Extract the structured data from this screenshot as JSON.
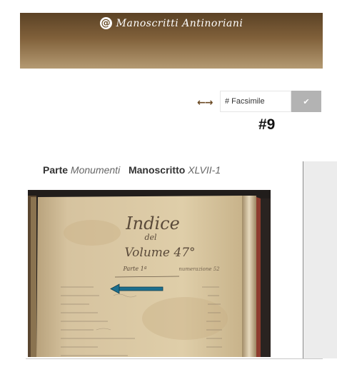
{
  "header": {
    "logo_mark": "@",
    "title": "Manoscritti Antinoriani"
  },
  "search": {
    "nav_arrows": "←→",
    "placeholder": "# Facsimile",
    "button_icon": "checkmark-icon"
  },
  "page_number": "#9",
  "meta": {
    "parte_label": "Parte",
    "parte_value": "Monumenti",
    "manoscritto_label": "Manoscritto",
    "manoscritto_value": "XLVII-1"
  },
  "facsimile": {
    "title_line1": "Indice",
    "title_line2": "del",
    "title_line3": "Volume 47°",
    "subtitle": "Parte 1ª",
    "subtitle_note": "numerazione 52",
    "arrow_color": "#1c6f8f"
  },
  "colors": {
    "header_top": "#5b4225",
    "header_bottom": "#b49a72",
    "accent": "#6b4a24"
  }
}
